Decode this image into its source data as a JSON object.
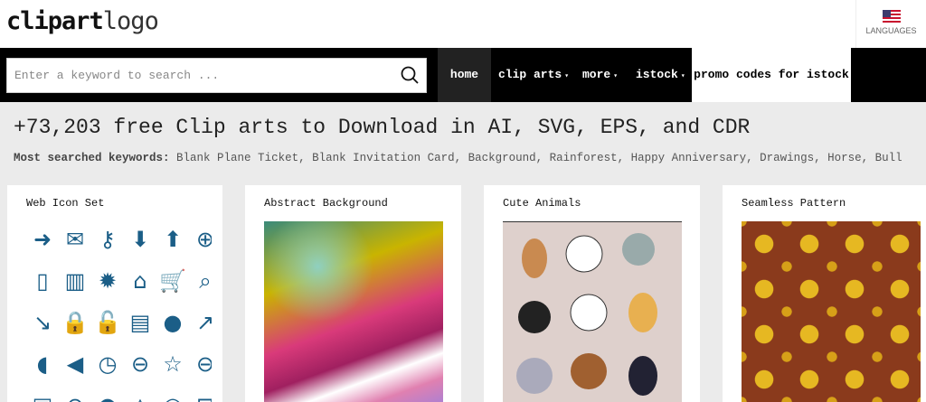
{
  "header": {
    "logo_bold": "clipart",
    "logo_light": "logo",
    "languages_label": "LANGUAGES"
  },
  "search": {
    "placeholder": "Enter a keyword to search ..."
  },
  "nav": {
    "items": [
      {
        "label": "home"
      },
      {
        "label": "clip arts"
      },
      {
        "label": "more"
      },
      {
        "label": "istock"
      },
      {
        "label": "promo codes for istock"
      }
    ],
    "caret": "▾"
  },
  "hero": {
    "title": "+73,203 free Clip arts to Download in AI, SVG, EPS, and CDR",
    "keywords_label": "Most searched keywords:",
    "keywords": "Blank Plane Ticket, Blank Invitation Card, Background, Rainforest, Happy Anniversary, Drawings, Horse, Bull"
  },
  "cards": [
    {
      "title": "Web Icon Set"
    },
    {
      "title": "Abstract Background"
    },
    {
      "title": "Cute Animals"
    },
    {
      "title": "Seamless Pattern"
    }
  ],
  "web_icons": [
    "➜",
    "✉",
    "⚷",
    "⬇",
    "⬆",
    "⊕",
    "▯",
    "▥",
    "✹",
    "⌂",
    "🛒",
    "⌕",
    "↘",
    "🔒",
    "🔓",
    "▤",
    "●",
    "↗",
    "◖",
    "◀",
    "◷",
    "⊖",
    "☆",
    "⊖",
    "▣",
    "⊘",
    "●",
    "△",
    "◠",
    "⊟"
  ],
  "colors": {
    "icon_blue": "#1b5e87",
    "nav_bg": "#000000",
    "home_bg": "#222222"
  }
}
